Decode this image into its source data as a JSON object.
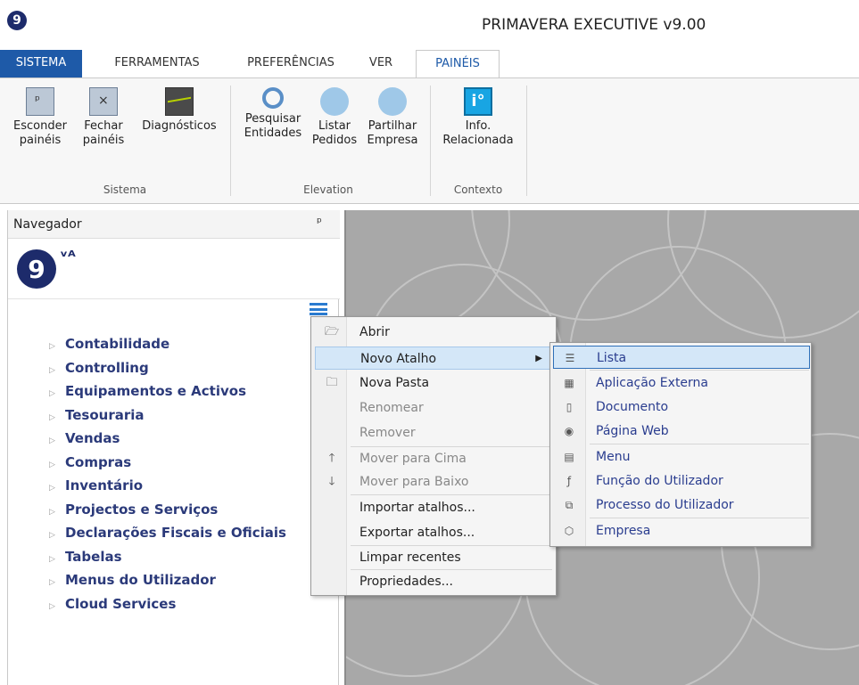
{
  "window": {
    "title": "PRIMAVERA EXECUTIVE v9.00",
    "logo_glyph": "9"
  },
  "menu_tabs": [
    "SISTEMA",
    "FERRAMENTAS",
    "PREFERÊNCIAS",
    "VER",
    "PAINÉIS"
  ],
  "ribbon": {
    "buttons": [
      {
        "line1": "Esconder",
        "line2": "painéis",
        "icon": "hide-panels-icon"
      },
      {
        "line1": "Fechar",
        "line2": "painéis",
        "icon": "close-panels-icon"
      },
      {
        "line1": "Diagnósticos",
        "line2": "",
        "icon": "diagnostics-icon"
      },
      {
        "line1": "Pesquisar",
        "line2": "Entidades",
        "icon": "search-entities-icon"
      },
      {
        "line1": "Listar",
        "line2": "Pedidos",
        "icon": "list-requests-icon"
      },
      {
        "line1": "Partilhar",
        "line2": "Empresa",
        "icon": "share-company-icon"
      },
      {
        "line1": "Info.",
        "line2": "Relacionada",
        "icon": "info-icon"
      }
    ],
    "groups": [
      "Sistema",
      "Elevation",
      "Contexto"
    ]
  },
  "navigator": {
    "title": "Navegador",
    "pin_glyph": "ᵖ",
    "logo_glyph": "9",
    "logo_mark": "ᵛᴬ",
    "items": [
      "Contabilidade",
      "Controlling",
      "Equipamentos e Activos",
      "Tesouraria",
      "Vendas",
      "Compras",
      "Inventário",
      "Projectos e Serviços",
      "Declarações Fiscais e Oficiais",
      "Tabelas",
      "Menus do Utilizador",
      "Cloud Services"
    ]
  },
  "context_menu": {
    "items": [
      {
        "label": "Abrir",
        "icon": "open-folder-icon",
        "enabled": true
      },
      {
        "label": "Novo Atalho",
        "icon": "",
        "enabled": true,
        "submenu": true
      },
      {
        "label": "Nova Pasta",
        "icon": "folder-icon",
        "enabled": true
      },
      {
        "label": "Renomear",
        "icon": "",
        "enabled": false
      },
      {
        "label": "Remover",
        "icon": "",
        "enabled": false
      },
      {
        "label": "Mover para Cima",
        "icon": "arrow-up-icon",
        "enabled": false
      },
      {
        "label": "Mover para Baixo",
        "icon": "arrow-down-icon",
        "enabled": false
      },
      {
        "label": "Importar atalhos...",
        "icon": "",
        "enabled": true
      },
      {
        "label": "Exportar atalhos...",
        "icon": "",
        "enabled": true
      },
      {
        "label": "Limpar recentes",
        "icon": "",
        "enabled": true
      },
      {
        "label": "Propriedades...",
        "icon": "",
        "enabled": true
      }
    ]
  },
  "submenu": {
    "items": [
      {
        "label": "Lista",
        "icon": "list-icon"
      },
      {
        "label": "Aplicação Externa",
        "icon": "external-app-icon"
      },
      {
        "label": "Documento",
        "icon": "document-icon"
      },
      {
        "label": "Página Web",
        "icon": "web-page-icon"
      },
      {
        "label": "Menu",
        "icon": "menu-icon"
      },
      {
        "label": "Função do Utilizador",
        "icon": "user-function-icon"
      },
      {
        "label": "Processo do Utilizador",
        "icon": "user-process-icon"
      },
      {
        "label": "Empresa",
        "icon": "company-icon"
      }
    ]
  },
  "colors": {
    "accent": "#1e5aa8",
    "nav_text": "#2b3a7a",
    "highlight": "#d4e7f8",
    "workspace": "#a8a8a8"
  }
}
